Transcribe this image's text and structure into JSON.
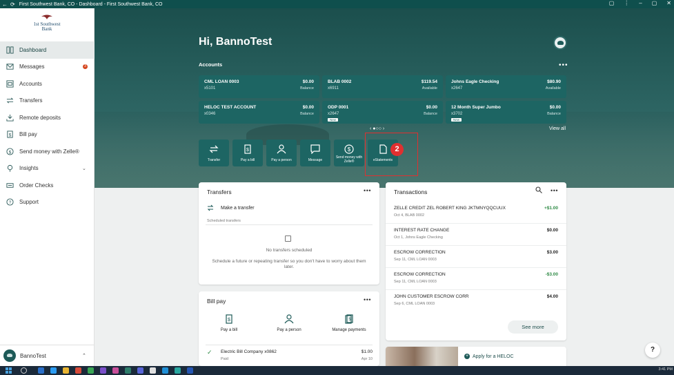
{
  "window": {
    "title": "First Southwest Bank, CO - Dashboard - First Southwest Bank, CO"
  },
  "brand": {
    "line1": "1st Southwest",
    "line2": "Bank"
  },
  "sidebar": {
    "items": [
      {
        "label": "Dashboard",
        "icon": "dashboard-icon",
        "active": true
      },
      {
        "label": "Messages",
        "icon": "mail-icon",
        "badge": "3"
      },
      {
        "label": "Accounts",
        "icon": "accounts-icon"
      },
      {
        "label": "Transfers",
        "icon": "transfer-icon"
      },
      {
        "label": "Remote deposits",
        "icon": "deposit-icon"
      },
      {
        "label": "Bill pay",
        "icon": "bill-icon"
      },
      {
        "label": "Send money with Zelle®",
        "icon": "dollar-icon"
      },
      {
        "label": "Insights",
        "icon": "lightbulb-icon",
        "expandable": true
      },
      {
        "label": "Order Checks",
        "icon": "checks-icon"
      },
      {
        "label": "Support",
        "icon": "help-icon"
      }
    ],
    "user": "BannoTest"
  },
  "greeting": "Hi, BannoTest",
  "accounts": {
    "heading": "Accounts",
    "view_all": "View all",
    "cards": [
      {
        "name": "CML LOAN 0003",
        "number": "x5101",
        "amount": "$0.00",
        "label": "Balance"
      },
      {
        "name": "BLAB 0002",
        "number": "x6911",
        "amount": "$119.54",
        "label": "Available"
      },
      {
        "name": "Johns Eagle Checking",
        "number": "x2647",
        "amount": "$80.90",
        "label": "Available"
      },
      {
        "name": "HELOC TEST ACCOUNT",
        "number": "x0346",
        "amount": "$0.00",
        "label": "Balance"
      },
      {
        "name": "ODP 0001",
        "number": "x2647",
        "amount": "$0.00",
        "label": "Balance",
        "tag": "New"
      },
      {
        "name": "12 Month Super Jumbo",
        "number": "x3702",
        "amount": "$0.00",
        "label": "Balance",
        "tag": "New"
      }
    ]
  },
  "quick_actions": [
    {
      "label": "Transfer",
      "icon": "transfer-icon"
    },
    {
      "label": "Pay a bill",
      "icon": "bill-icon"
    },
    {
      "label": "Pay a person",
      "icon": "person-icon"
    },
    {
      "label": "Message",
      "icon": "message-icon"
    },
    {
      "label": "Send money with Zelle®",
      "icon": "dollar-icon"
    },
    {
      "label": "eStatements",
      "icon": "document-icon"
    }
  ],
  "annotation": {
    "step": "2"
  },
  "transfers": {
    "heading": "Transfers",
    "make": "Make a transfer",
    "scheduled": "Scheduled transfers",
    "empty_title": "No transfers scheduled",
    "empty_body": "Schedule a future or repeating transfer so you don't have to worry about them later."
  },
  "transactions": {
    "heading": "Transactions",
    "see_more": "See more",
    "rows": [
      {
        "desc": "ZELLE CREDIT ZEL ROBERT KING JKTMNYQQCUUX",
        "sub": "Oct 4, BLAB 0002",
        "amount": "+$1.00",
        "positive": true
      },
      {
        "desc": "INTEREST RATE CHANGE",
        "sub": "Oct 1, Johns Eagle Checking",
        "amount": "$0.00"
      },
      {
        "desc": "ESCROW CORRECTION",
        "sub": "Sep 11, CML LOAN 0003",
        "amount": "$3.00"
      },
      {
        "desc": "ESCROW CORRECTION",
        "sub": "Sep 11, CML LOAN 0003",
        "amount": "-$3.00",
        "positive": true
      },
      {
        "desc": "JOHN CUSTOMER ESCROW CORR",
        "sub": "Sep 6, CML LOAN 0003",
        "amount": "$4.00"
      }
    ]
  },
  "billpay": {
    "heading": "Bill pay",
    "actions": [
      "Pay a bill",
      "Pay a person",
      "Manage payments"
    ],
    "row": {
      "name": "Electric Bill Company x0862",
      "status": "Paid",
      "amount": "$1.00",
      "date": "Apr 10"
    }
  },
  "promo": {
    "link": "Apply for a HELOC"
  },
  "help": "?",
  "clock": "3:41 PM"
}
